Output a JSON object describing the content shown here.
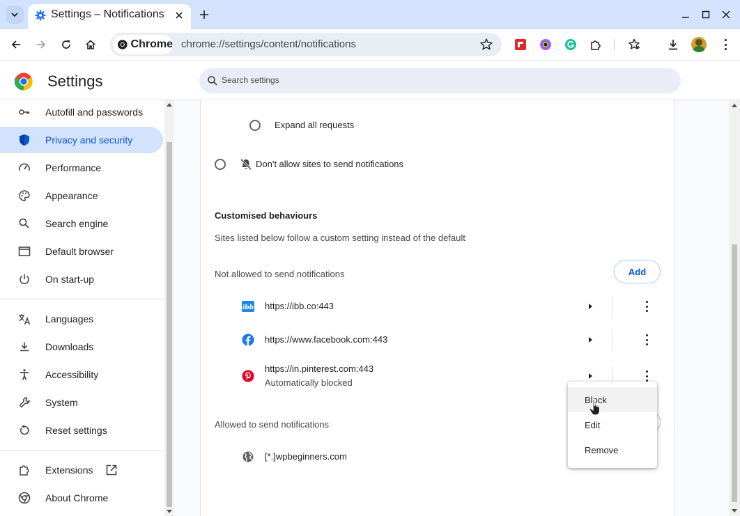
{
  "browser": {
    "tab_title": "Settings – Notifications",
    "new_tab_label": "+",
    "chip_label": "Chrome",
    "url": "chrome://settings/content/notifications"
  },
  "header": {
    "title": "Settings",
    "search_placeholder": "Search settings"
  },
  "sidebar": {
    "items": [
      {
        "label": "Autofill and passwords",
        "icon": "key-icon"
      },
      {
        "label": "Privacy and security",
        "icon": "shield-icon",
        "active": true
      },
      {
        "label": "Performance",
        "icon": "speedometer-icon"
      },
      {
        "label": "Appearance",
        "icon": "palette-icon"
      },
      {
        "label": "Search engine",
        "icon": "search-icon"
      },
      {
        "label": "Default browser",
        "icon": "browser-window-icon"
      },
      {
        "label": "On start-up",
        "icon": "power-icon"
      },
      {
        "label": "Languages",
        "icon": "translate-icon"
      },
      {
        "label": "Downloads",
        "icon": "download-icon"
      },
      {
        "label": "Accessibility",
        "icon": "accessibility-icon"
      },
      {
        "label": "System",
        "icon": "wrench-icon"
      },
      {
        "label": "Reset settings",
        "icon": "reset-icon"
      },
      {
        "label": "Extensions",
        "icon": "puzzle-icon"
      },
      {
        "label": "About Chrome",
        "icon": "chrome-icon"
      }
    ]
  },
  "main": {
    "expand_all_label": "Expand all requests",
    "dont_allow_label": "Don't allow sites to send notifications",
    "custom_heading": "Customised behaviours",
    "custom_desc": "Sites listed below follow a custom setting instead of the default",
    "not_allowed_heading": "Not allowed to send notifications",
    "add_label": "Add",
    "blocked_sites": [
      {
        "url": "https://ibb.co:443",
        "icon": "ibb-favicon"
      },
      {
        "url": "https://www.facebook.com:443",
        "icon": "facebook-favicon"
      },
      {
        "url": "https://in.pinterest.com:443",
        "sub": "Automatically blocked",
        "icon": "pinterest-favicon"
      }
    ],
    "allowed_heading": "Allowed to send notifications",
    "allowed_sites": [
      {
        "url": "[*.]wpbeginners.com",
        "icon": "globe-icon"
      }
    ]
  },
  "context_menu": {
    "items": [
      "Block",
      "Edit",
      "Remove"
    ],
    "hovered": "Block"
  },
  "colors": {
    "accent": "#0b57d0",
    "active_nav_bg": "#d3e3fd",
    "tabstrip_bg": "#d3e3fd"
  }
}
